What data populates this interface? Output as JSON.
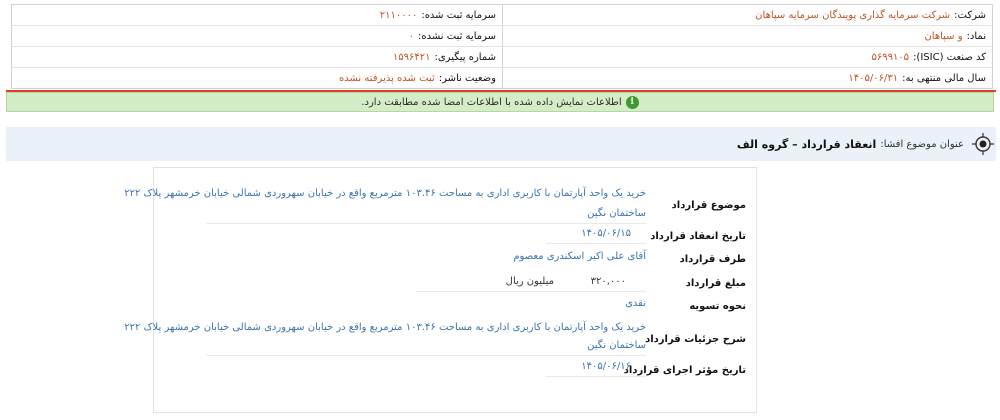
{
  "info": {
    "company_label": "شرکت:",
    "company_value": "شرکت سرمایه گذاری پویندگان سرمایه سپاهان",
    "reg_capital_label": "سرمایه ثبت شده:",
    "reg_capital_value": "۲۱۱۰۰۰۰",
    "symbol_label": "نماد:",
    "symbol_value": "و سپاهان",
    "unreg_capital_label": "سرمایه ثبت نشده:",
    "unreg_capital_value": "۰",
    "isic_label": "کد صنعت (ISIC):",
    "isic_value": "۵۶۹۹۱۰۵",
    "tracking_label": "شماره پیگیری:",
    "tracking_value": "۱۵۹۶۴۲۱",
    "fiscal_label": "سال مالی منتهی به:",
    "fiscal_value": "۱۴۰۵/۰۶/۳۱",
    "publisher_label": "وضعیت ناشر:",
    "publisher_value": "ثبت شده پذیرفته نشده"
  },
  "notice": {
    "text": "اطلاعات نمایش داده شده با اطلاعات امضا شده مطابقت دارد."
  },
  "subject": {
    "label": "عنوان موضوع افشا:",
    "value": "انعقاد قرارداد – گروه الف"
  },
  "fields": {
    "subject_label": "موضوع قرارداد",
    "subject_line1": "خرید یک واحد آپارتمان با کاربری اداری به مساحت ۱۰۳.۴۶ مترمربع واقع در خیابان سهروردی شمالی خیابان خرمشهر پلاک ۲۲۲",
    "subject_line2": "ساختمان نگین",
    "date_label": "تاریخ انعقاد قرارداد",
    "date_value": "۱۴۰۵/۰۶/۱۵",
    "party_label": "طرف قرارداد",
    "party_value": "آقای علی اکبر اسکندری معصوم",
    "amount_label": "مبلغ قرارداد",
    "amount_value": "۳۲۰,۰۰۰",
    "amount_unit": "میلیون ریال",
    "settlement_label": "نحوه تسویه",
    "settlement_value": "نقدی",
    "details_label": "شرح جزئیات قرارداد",
    "details_line1": "خرید یک واحد آپارتمان با کاربری اداری به مساحت ۱۰۳.۴۶ مترمربع واقع در خیابان سهروردی شمالی خیابان خرمشهر پلاک ۲۲۲",
    "details_line2": "ساختمان نگین",
    "effective_label": "تاریخ مؤثر اجرای قرارداد",
    "effective_value": "۱۴۰۵/۰۶/۱۶"
  }
}
